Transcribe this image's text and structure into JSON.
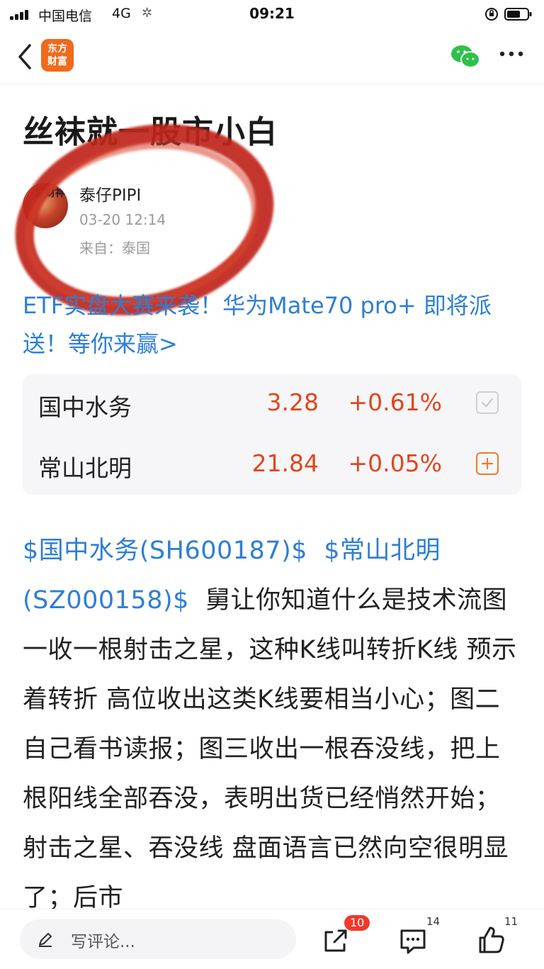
{
  "status_bar": {
    "carrier": "中国电信",
    "network": "4G",
    "time": "09:21"
  },
  "nav": {
    "logo_line1": "东方",
    "logo_line2": "财富"
  },
  "article": {
    "title": "丝袜就一股市小白",
    "author": "泰仔PIPI",
    "time": "03-20 12:14",
    "from": "来自：泰国",
    "avatar_text": "迎财神",
    "promo": "ETF实盘大赛来袭！华为Mate70 pro+ 即将派送！等你来赢>"
  },
  "quotes": [
    {
      "name": "国中水务",
      "price": "3.28",
      "change": "+0.61%"
    },
    {
      "name": "常山北明",
      "price": "21.84",
      "change": "+0.05%"
    }
  ],
  "body": {
    "link1": "$国中水务(SH600187)$",
    "link2": "$常山北明(SZ000158)$",
    "text": "舅让你知道什么是技术流图一收一根射击之星，这种K线叫转折K线 预示着转折 高位收出这类K线要相当小心；图二自己看书读报；图三收出一根吞没线，把上根阳线全部吞没，表明出货已经悄然开始；射击之星、吞没线 盘面语言已然向空很明显了；后市"
  },
  "bottom_bar": {
    "comment_placeholder": "写评论...",
    "share_badge": "10",
    "comment_count": "14",
    "like_count": "11"
  },
  "colors": {
    "brand_orange": "#f06a1c",
    "link_blue": "#2d7fd4",
    "up_red": "#e2451e",
    "annotation_red": "#c0281a"
  }
}
